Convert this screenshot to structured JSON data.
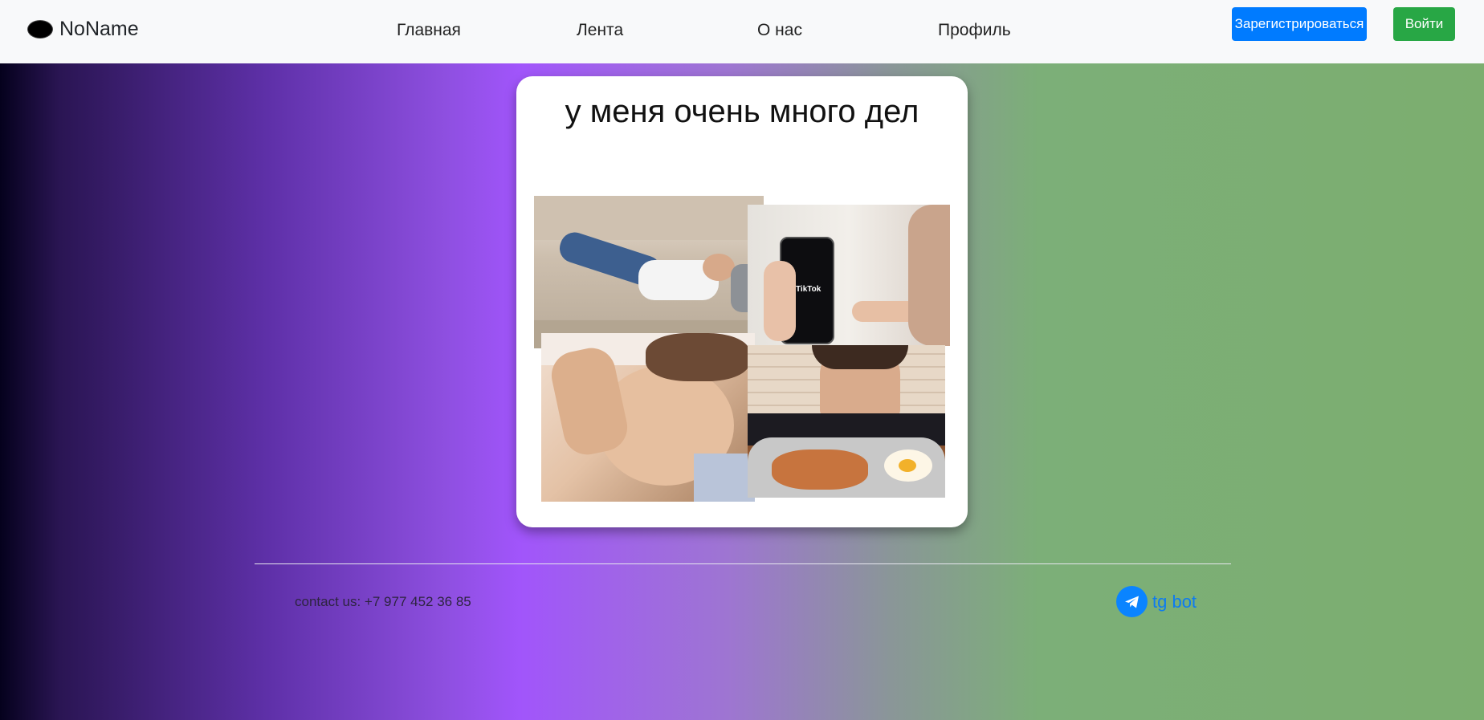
{
  "navbar": {
    "brand": "NoName",
    "links": [
      "Главная",
      "Лента",
      "О нас",
      "Профиль"
    ],
    "register_label": "Зарегистрироваться",
    "login_label": "Войти",
    "colors": {
      "background": "#f8f9fa",
      "register": "#007bff",
      "login": "#28a745"
    }
  },
  "post": {
    "caption": "у меня очень много дел",
    "photo_icons": [
      "couch-photo",
      "tiktok-phone-photo",
      "headache-photo",
      "food-photo"
    ],
    "phone_app_label": "TikTok"
  },
  "footer": {
    "contact": "contact us: +7 977 452 36 85",
    "tg_link": "tg bot",
    "tg_icon": "telegram-icon",
    "colors": {
      "tg_link": "#0d7bf0"
    }
  }
}
